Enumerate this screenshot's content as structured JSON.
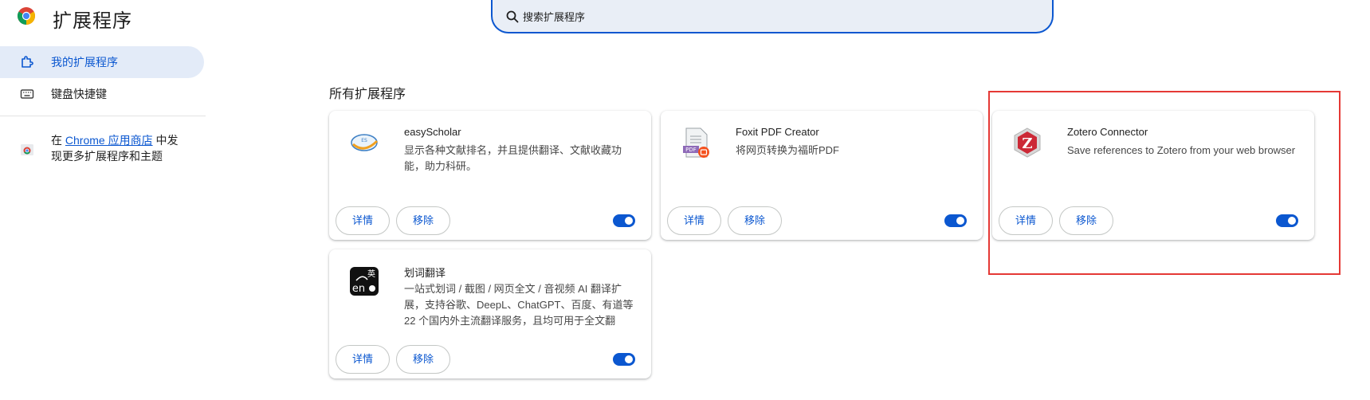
{
  "header": {
    "title": "扩展程序",
    "logo_icon": "chrome-logo-icon"
  },
  "search": {
    "placeholder": "搜索扩展程序",
    "icon": "search-icon"
  },
  "sidebar": {
    "items": [
      {
        "label": "我的扩展程序",
        "icon": "puzzle-icon",
        "active": true
      },
      {
        "label": "键盘快捷键",
        "icon": "keyboard-icon",
        "active": false
      }
    ],
    "store_note": {
      "prefix": "在 ",
      "link": "Chrome 应用商店",
      "suffix": " 中发现更多扩展程序和主题"
    }
  },
  "main": {
    "section_title": "所有扩展程序",
    "extensions": [
      {
        "name": "easyScholar",
        "description": "显示各种文献排名，并且提供翻译、文献收藏功能，助力科研。",
        "icon": "easyscholar-icon",
        "details_label": "详情",
        "remove_label": "移除",
        "enabled": true
      },
      {
        "name": "Foxit PDF Creator",
        "description": "将网页转换为福昕PDF",
        "icon": "pdf-file-icon",
        "details_label": "详情",
        "remove_label": "移除",
        "enabled": true
      },
      {
        "name": "Zotero Connector",
        "description": "Save references to Zotero from your web browser",
        "icon": "zotero-icon",
        "details_label": "详情",
        "remove_label": "移除",
        "enabled": true
      },
      {
        "name": "划词翻译",
        "description": "一站式划词 / 截图 / 网页全文 / 音视频 AI 翻译扩展，支持谷歌、DeepL、ChatGPT、百度、有道等 22 个国内外主流翻译服务，且均可用于全文翻",
        "icon": "translate-en-icon",
        "details_label": "详情",
        "remove_label": "移除",
        "enabled": true
      }
    ]
  },
  "colors": {
    "accent": "#0b57d0",
    "active_bg": "#e3ebf8",
    "search_bg": "#e9eef6",
    "highlight": "#e53935"
  }
}
